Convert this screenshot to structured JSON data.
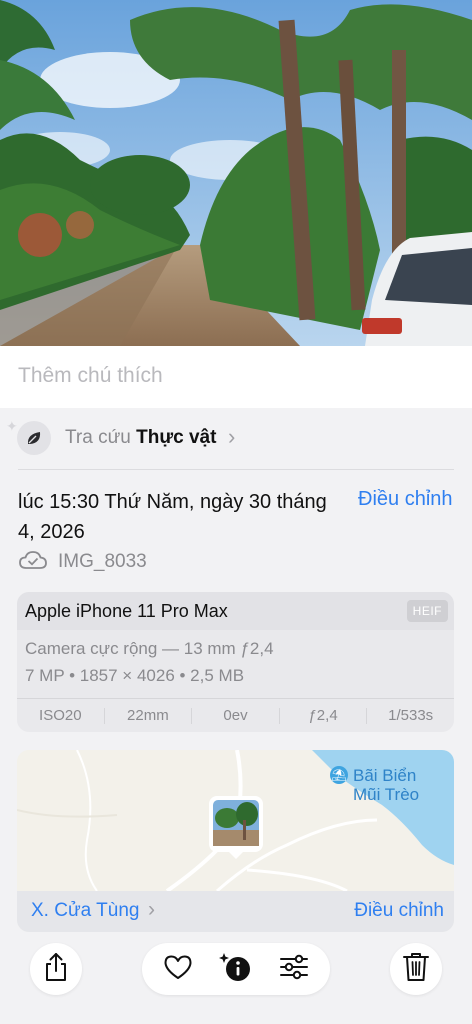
{
  "caption": {
    "placeholder": "Thêm chú thích"
  },
  "lookup": {
    "prefix": "Tra cứu",
    "subject": "Thực vật"
  },
  "date": {
    "text": "lúc 15:30 Thứ Năm, ngày 30 tháng 4, 2026",
    "adjust_label": "Điều chỉnh"
  },
  "file": {
    "name": "IMG_8033"
  },
  "camera": {
    "model": "Apple iPhone 11 Pro Max",
    "format": "HEIF",
    "lens": "Camera cực rộng — 13 mm ƒ2,4",
    "details": "7 MP • 1857 × 4026 • 2,5 MB",
    "stats": [
      "ISO20",
      "22mm",
      "0ev",
      "ƒ2,4",
      "1/533s"
    ]
  },
  "map": {
    "poi_line1": "Bãi Biển",
    "poi_line2": "Mũi Trèo",
    "place": "X. Cửa Tùng",
    "adjust_label": "Điều chỉnh"
  },
  "colors": {
    "accent": "#2f7ff0",
    "secondary_text": "#8a8a8e"
  },
  "icons": {
    "share": "share-icon",
    "favorite": "heart-icon",
    "info": "info-sparkle-icon",
    "edit": "sliders-icon",
    "delete": "trash-icon"
  }
}
